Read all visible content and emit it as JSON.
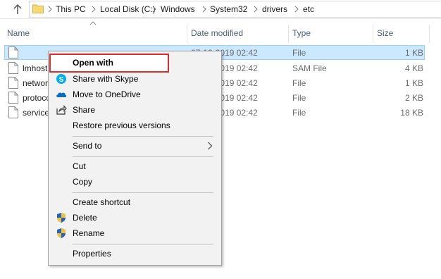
{
  "address_bar": {
    "crumbs": [
      "This PC",
      "Local Disk (C:)",
      "Windows",
      "System32",
      "drivers",
      "etc"
    ]
  },
  "columns": {
    "name": "Name",
    "date": "Date modified",
    "type": "Type",
    "size": "Size"
  },
  "files": [
    {
      "name": "",
      "date": "07-12-2019 02:42",
      "type": "File",
      "size": "1 KB"
    },
    {
      "name": "lmhosts",
      "date": "07-12-2019 02:42",
      "type": "SAM File",
      "size": "4 KB"
    },
    {
      "name": "networks",
      "date": "07-12-2019 02:42",
      "type": "File",
      "size": "1 KB"
    },
    {
      "name": "protocol",
      "date": "07-12-2019 02:42",
      "type": "File",
      "size": "2 KB"
    },
    {
      "name": "services",
      "date": "07-12-2019 02:42",
      "type": "File",
      "size": "18 KB"
    }
  ],
  "context_menu": {
    "open_with": "Open with",
    "share_skype": "Share with Skype",
    "onedrive": "Move to OneDrive",
    "share": "Share",
    "restore": "Restore previous versions",
    "send_to": "Send to",
    "cut": "Cut",
    "copy": "Copy",
    "create_shortcut": "Create shortcut",
    "delete": "Delete",
    "rename": "Rename",
    "properties": "Properties"
  },
  "colors": {
    "selection": "#cce8ff",
    "highlight_box": "#d92d2d",
    "header_text": "#4c607a"
  }
}
